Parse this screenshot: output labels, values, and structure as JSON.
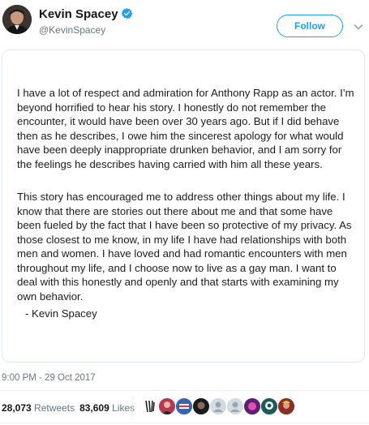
{
  "tweet": {
    "author_name": "Kevin Spacey",
    "author_handle": "@KevinSpacey",
    "verified_icon": "verified-badge-icon",
    "follow_label": "Follow",
    "menu_icon": "chevron-down-icon",
    "statement_paragraphs": [
      "I have a lot of respect and admiration for Anthony Rapp as an actor. I’m beyond horrified to hear his story. I honestly do not remember the encounter, it would have been over 30 years ago. But if I did behave then as he describes, I owe him the sincerest apology for what would have been deeply inappropriate drunken behavior, and I am sorry for the feelings he describes having carried with him all these years.",
      "This story has encouraged me to address other things about my life. I know that there are stories out there about me and that some have been fueled by the fact that I have been so protective of my privacy. As those closest to me know, in my life I have had relationships with both men and women. I have loved and had romantic encounters with men throughout my life, and I choose now to live as a gay man.  I want to deal with this honestly and openly and that starts with examining my own behavior."
    ],
    "signature": "- Kevin Spacey",
    "timestamp": "9:00 PM - 29 Oct 2017",
    "retweets_count": "28,073",
    "retweets_label": "Retweets",
    "likes_count": "83,609",
    "likes_label": "Likes",
    "likers_count_shown": 9
  },
  "colors": {
    "accent": "#1da1f2",
    "secondary_text": "#657786",
    "border": "#e1e8ed"
  }
}
